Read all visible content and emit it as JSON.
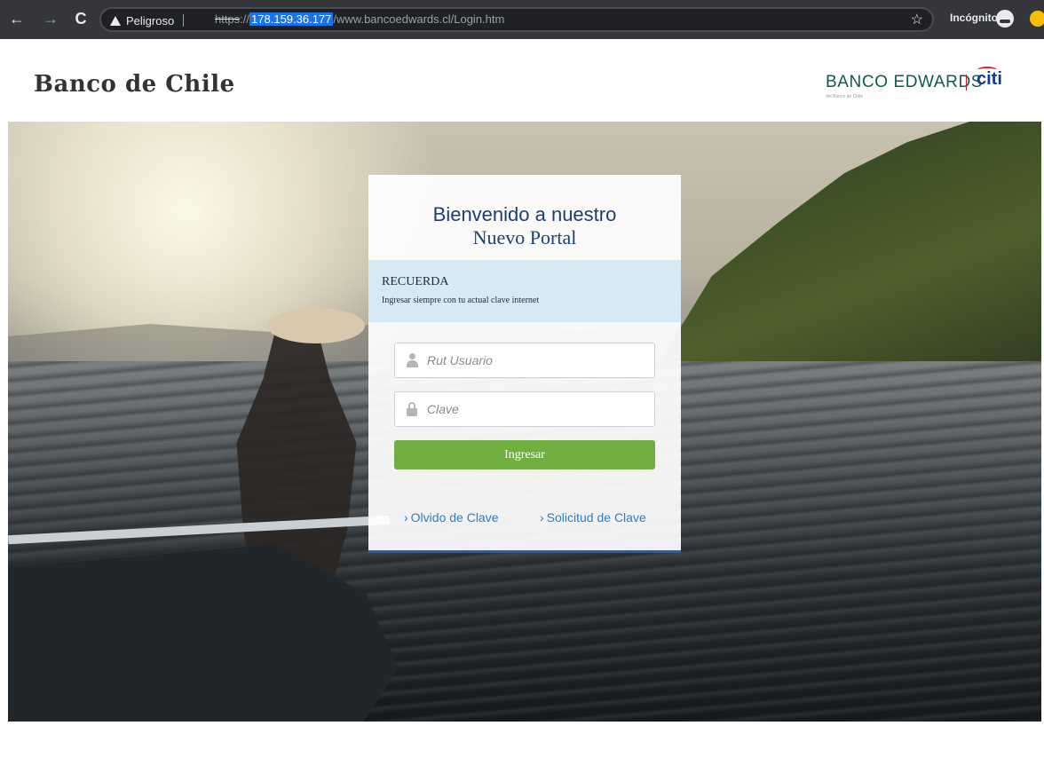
{
  "browser": {
    "back": "←",
    "forward": "→",
    "reload": "C",
    "security_label": "Peligroso",
    "url_scheme": "https",
    "url_sep": "://",
    "url_host": "178.159.36.177",
    "url_path": "/www.bancoedwards.cl/Login.htm",
    "bookmark": "☆",
    "incognito_label": "Incógnito"
  },
  "header": {
    "left_brand": "Banco de Chile",
    "right_brand": "BANCO EDWARDS",
    "right_brand_sub": "del Banco de Chile",
    "citi": "citi"
  },
  "login": {
    "title_line1": "Bienvenido a nuestro",
    "title_line2": "Nuevo Portal",
    "notice_heading": "RECUERDA",
    "notice_body": "Ingresar siempre con tu actual clave internet",
    "user_placeholder": "Rut Usuario",
    "password_placeholder": "Clave",
    "submit_label": "Ingresar",
    "forgot_label": "Olvido de Clave",
    "request_label": "Solicitud de Clave"
  },
  "colors": {
    "title_blue": "#1d3f73",
    "link_blue": "#2d7ec4",
    "button_green": "#6fae3f",
    "notice_bg": "#d6e8f6"
  }
}
